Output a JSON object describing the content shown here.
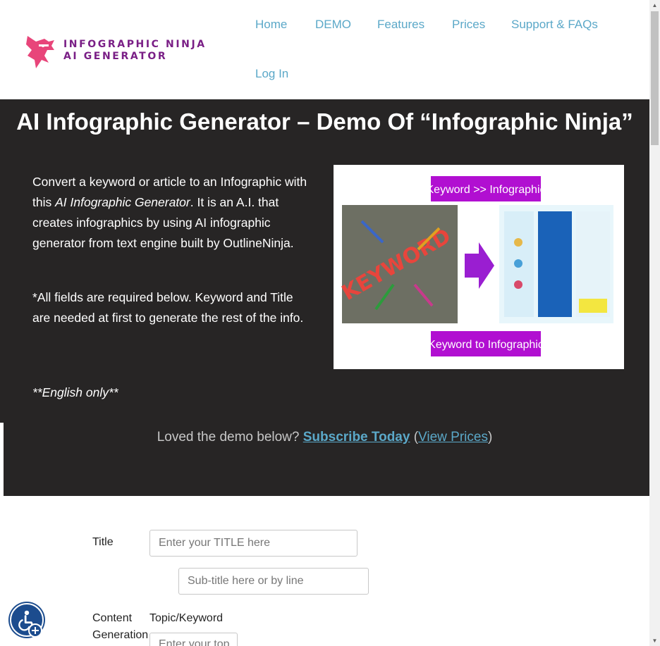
{
  "header": {
    "logo_line1": "INFOGRAPHIC NINJA",
    "logo_line2": "AI GENERATOR",
    "nav": [
      "Home",
      "DEMO",
      "Features",
      "Prices",
      "Support & FAQs",
      "Log In"
    ]
  },
  "hero": {
    "title": "AI Infographic Generator – Demo Of “Infographic Ninja”",
    "intro_part1": "Convert a keyword or article to an Infographic with this ",
    "intro_italic": "AI Infographic Generator",
    "intro_part2": ". It is an A.I. that creates infographics by using AI infographic generator from text engine built by OutlineNinja.",
    "required_note": "*All fields are required below. Keyword and Title are needed at first to generate the rest of the info.",
    "english_only": "**English only**",
    "image": {
      "top_label": "Keyword >> Infographic",
      "bottom_label": "Keyword to Infographic",
      "keyword_text": "KEYWORD"
    },
    "loved_text": "Loved the demo below?",
    "subscribe_link": "Subscribe Today",
    "prices_link": "View Prices"
  },
  "form": {
    "title_label": "Title",
    "title_placeholder": "Enter your TITLE here",
    "subtitle_placeholder": "Sub-title here or by line",
    "content_label_1": "Content",
    "content_label_2": "Generation",
    "topic_label": "Topic/Keyword",
    "topic_placeholder": "Enter your top"
  },
  "colors": {
    "link": "#5ba8c8",
    "logo_purple": "#7a1f86",
    "logo_pink": "#e8457a",
    "hero_bg": "#272525",
    "a11y_blue": "#1c4c8e"
  }
}
